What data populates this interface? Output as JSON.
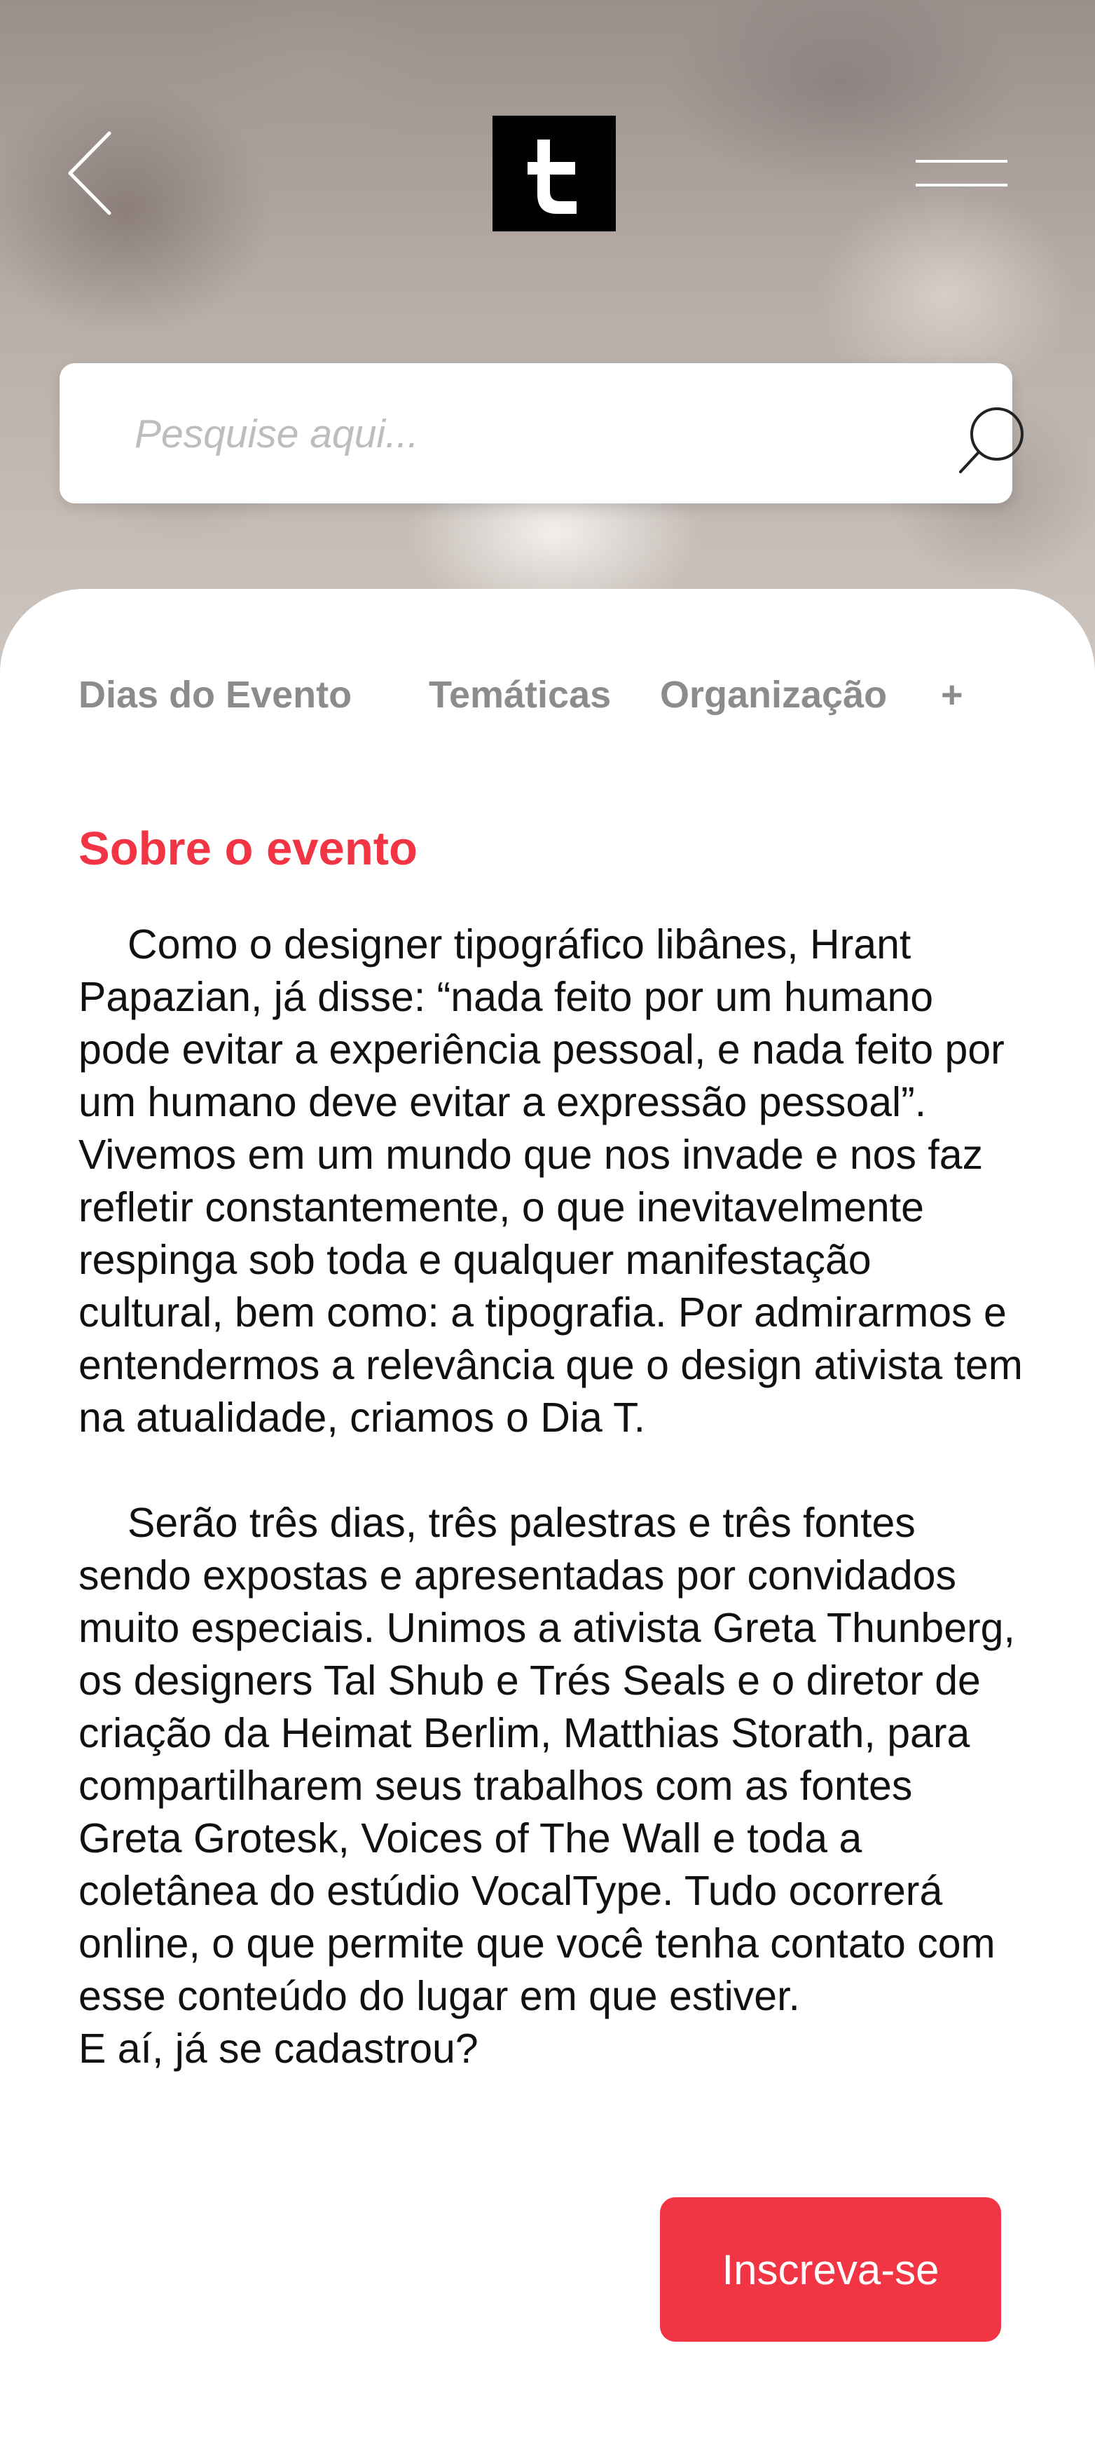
{
  "header": {
    "back_icon": "chevron-left-icon",
    "logo_letter": "t",
    "menu_icon": "hamburger-menu-icon"
  },
  "search": {
    "placeholder": "Pesquise aqui...",
    "value": "",
    "icon": "search-icon"
  },
  "tabs": [
    {
      "label": "Dias do Evento"
    },
    {
      "label": "Temáticas"
    },
    {
      "label": "Organização"
    },
    {
      "label": "+"
    }
  ],
  "about": {
    "title": "Sobre o evento",
    "paragraph_1": "Como o designer tipográfico libânes, Hrant Papazian, já disse: “nada feito por um humano pode evitar a experiência pessoal, e nada feito por um humano deve evitar a expressão pessoal”. Vivemos em um mundo que nos invade e nos faz refletir constantemente, o que inevitavelmente respinga sob toda e qualquer manifestação cultural, bem como: a tipografia. Por admirarmos e entendermos a relevância que o design ativista tem na atualidade, criamos o Dia T.",
    "paragraph_2": "Serão três dias, três palestras e três fontes sendo expostas e apresentadas por convidados muito especiais. Unimos a ativista Greta Thunberg, os designers Tal Shub e Trés Seals e o diretor de criação da Heimat Berlim, Matthias Storath, para compartilharem seus trabalhos com as fontes Greta Grotesk, Voices of The Wall e toda a coletânea do estúdio VocalType. Tudo ocorrerá online, o que permite que você tenha contato com esse conteúdo do lugar em que estiver.",
    "closing": "E aí, já se cadastrou?"
  },
  "cta": {
    "label": "Inscreva-se"
  },
  "colors": {
    "accent": "#f23544",
    "tab_text": "#8c8c8c",
    "body_text": "#111111",
    "placeholder": "#bdbdbd"
  }
}
